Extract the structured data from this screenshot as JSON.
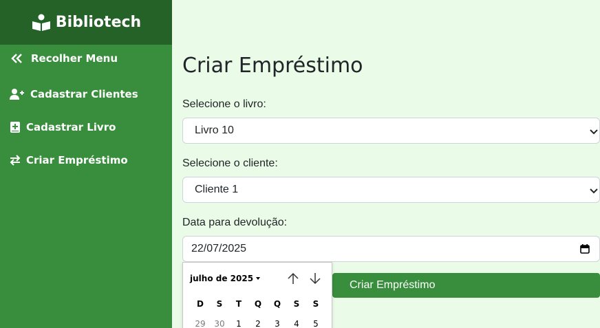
{
  "brand": {
    "name": "Bibliotech",
    "icon": "book-reader-icon"
  },
  "sidebar": {
    "items": [
      {
        "label": "Recolher Menu",
        "icon": "double-chevron-left-icon"
      },
      {
        "label": "Cadastrar Clientes",
        "icon": "user-plus-icon"
      },
      {
        "label": "Cadastrar Livro",
        "icon": "book-plus-icon"
      },
      {
        "label": "Criar Empréstimo",
        "icon": "exchange-arrows-icon"
      }
    ]
  },
  "main": {
    "title": "Criar Empréstimo",
    "book_label": "Selecione o livro:",
    "book_value": "Livro 10",
    "client_label": "Selecione o cliente:",
    "client_value": "Cliente 1",
    "date_label": "Data para devolução:",
    "date_value": "22/07/2025",
    "submit_label": "Criar Empréstimo"
  },
  "datepicker": {
    "month_label": "julho de 2025",
    "weekdays": [
      "D",
      "S",
      "T",
      "Q",
      "Q",
      "S",
      "S"
    ],
    "first_row": [
      {
        "day": "29",
        "muted": true
      },
      {
        "day": "30",
        "muted": true
      },
      {
        "day": "1",
        "muted": false
      },
      {
        "day": "2",
        "muted": false
      },
      {
        "day": "3",
        "muted": false
      },
      {
        "day": "4",
        "muted": false
      },
      {
        "day": "5",
        "muted": false
      }
    ]
  },
  "colors": {
    "sidebar": "#388e3c",
    "brand_bar": "#256227",
    "page_background": "#eafce8",
    "button": "#388e3c"
  }
}
